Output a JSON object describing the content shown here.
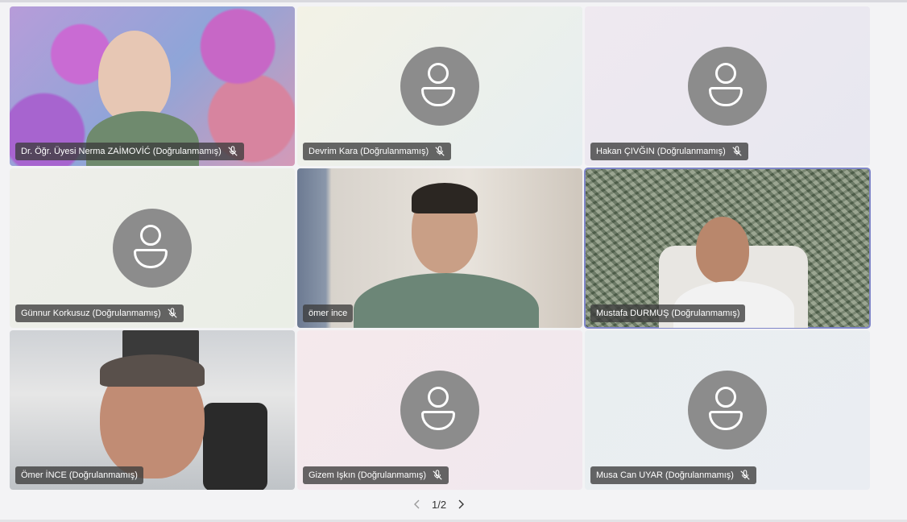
{
  "participants": [
    {
      "name": "Dr. Öğr. Üyesi Nerma ZAİMOVİĆ (Doğrulanmamış)",
      "muted": true,
      "video": true
    },
    {
      "name": "Devrim Kara (Doğrulanmamış)",
      "muted": true,
      "video": false
    },
    {
      "name": "Hakan ÇIVĞIN (Doğrulanmamış)",
      "muted": true,
      "video": false
    },
    {
      "name": "Günnur Korkusuz (Doğrulanmamış)",
      "muted": true,
      "video": false
    },
    {
      "name": "ömer ince",
      "muted": false,
      "video": true
    },
    {
      "name": "Mustafa DURMUŞ (Doğrulanmamış)",
      "muted": false,
      "video": true,
      "active_speaker": true
    },
    {
      "name": "Ömer İNCE (Doğrulanmamış)",
      "muted": false,
      "video": true
    },
    {
      "name": "Gizem Işkın (Doğrulanmamış)",
      "muted": true,
      "video": false
    },
    {
      "name": "Musa Can UYAR (Doğrulanmamış)",
      "muted": true,
      "video": false
    }
  ],
  "pagination": {
    "text": "1/2"
  },
  "icons": {
    "avatar": "person-icon",
    "mute": "mic-off-icon",
    "prev": "chevron-left-icon",
    "next": "chevron-right-icon"
  },
  "colors": {
    "active_border": "#7f85c8",
    "avatar_bg": "#8c8c8c",
    "label_bg": "#3c3c3c"
  }
}
